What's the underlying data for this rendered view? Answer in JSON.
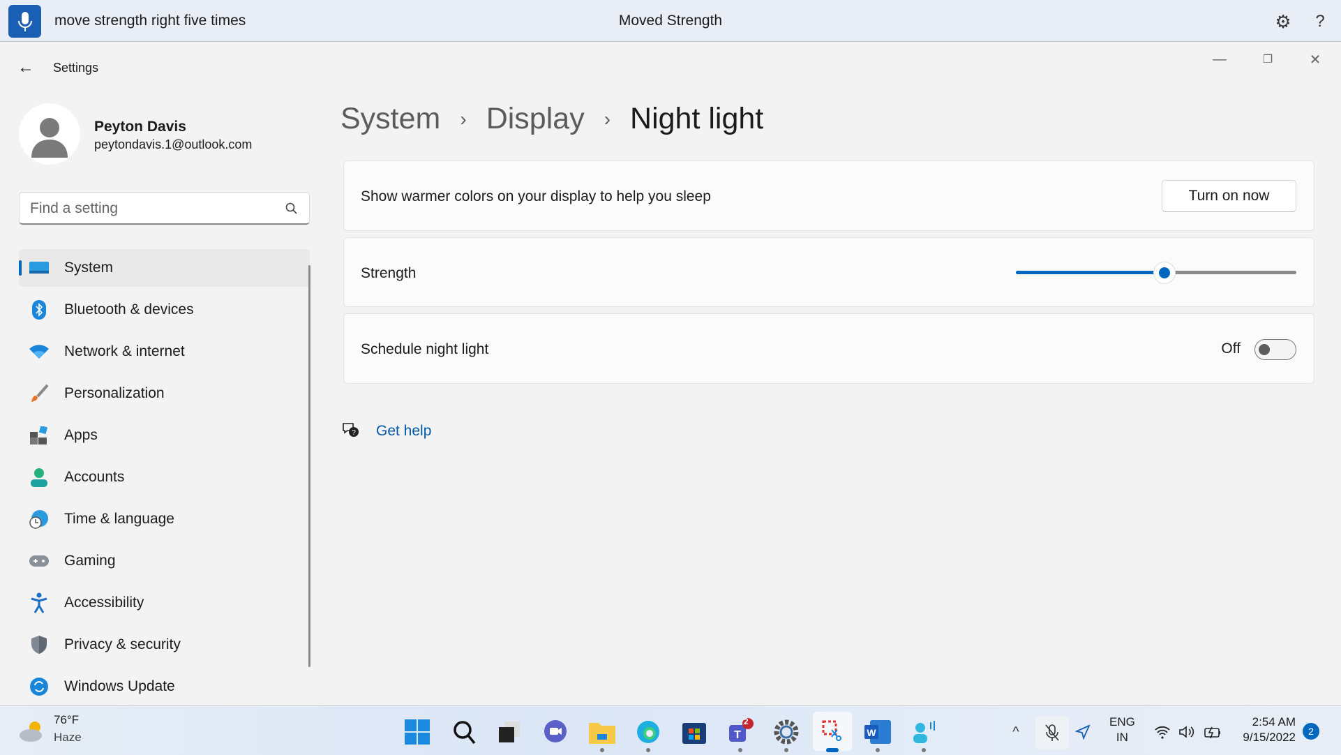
{
  "voice_bar": {
    "command": "move strength right five times",
    "status": "Moved Strength",
    "icons": [
      "microphone-icon",
      "gear-icon",
      "help-icon"
    ]
  },
  "window": {
    "title": "Settings"
  },
  "user": {
    "name": "Peyton Davis",
    "email": "peytondavis.1@outlook.com"
  },
  "search": {
    "placeholder": "Find a setting"
  },
  "sidebar": {
    "items": [
      {
        "label": "System",
        "icon": "system-icon",
        "selected": true
      },
      {
        "label": "Bluetooth & devices",
        "icon": "bluetooth-icon"
      },
      {
        "label": "Network & internet",
        "icon": "wifi-icon"
      },
      {
        "label": "Personalization",
        "icon": "brush-icon"
      },
      {
        "label": "Apps",
        "icon": "apps-icon"
      },
      {
        "label": "Accounts",
        "icon": "accounts-icon"
      },
      {
        "label": "Time & language",
        "icon": "globe-clock-icon"
      },
      {
        "label": "Gaming",
        "icon": "gamepad-icon"
      },
      {
        "label": "Accessibility",
        "icon": "accessibility-icon"
      },
      {
        "label": "Privacy & security",
        "icon": "shield-icon"
      },
      {
        "label": "Windows Update",
        "icon": "update-icon"
      }
    ]
  },
  "breadcrumb": [
    "System",
    "Display",
    "Night light"
  ],
  "cards": {
    "intro": {
      "label": "Show warmer colors on your display to help you sleep",
      "button": "Turn on now"
    },
    "strength": {
      "label": "Strength",
      "value_percent": 53
    },
    "schedule": {
      "label": "Schedule night light",
      "state": "Off",
      "on": false
    }
  },
  "help": {
    "label": "Get help"
  },
  "taskbar": {
    "weather": {
      "temp": "76°F",
      "condition": "Haze"
    },
    "teams_badge": "2",
    "lang": [
      "ENG",
      "IN"
    ],
    "time": "2:54 AM",
    "date": "9/15/2022",
    "notifications": "2",
    "accent": "#0067c0"
  }
}
